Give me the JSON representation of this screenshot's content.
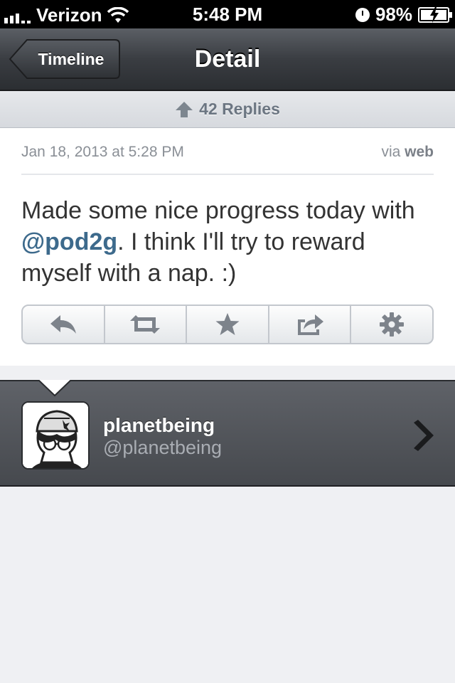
{
  "status_bar": {
    "carrier": "Verizon",
    "time": "5:48 PM",
    "battery": "98%"
  },
  "nav": {
    "back_label": "Timeline",
    "title": "Detail"
  },
  "replies": {
    "label": "42 Replies"
  },
  "tweet": {
    "date": "Jan 18, 2013 at 5:28 PM",
    "via_prefix": "via",
    "via_source": "web",
    "text_before": "Made some nice progress today with ",
    "mention": "@pod2g",
    "text_after": ". I think I'll try to reward myself with a nap. :)"
  },
  "actions": [
    {
      "icon": "reply-icon"
    },
    {
      "icon": "retweet-icon"
    },
    {
      "icon": "star-icon"
    },
    {
      "icon": "share-icon"
    },
    {
      "icon": "gear-icon"
    }
  ],
  "user": {
    "name": "planetbeing",
    "handle": "@planetbeing"
  },
  "colors": {
    "mention": "#3d6a8c",
    "nav_bar": "#3a3d42",
    "icon_gray": "#7d838b"
  }
}
